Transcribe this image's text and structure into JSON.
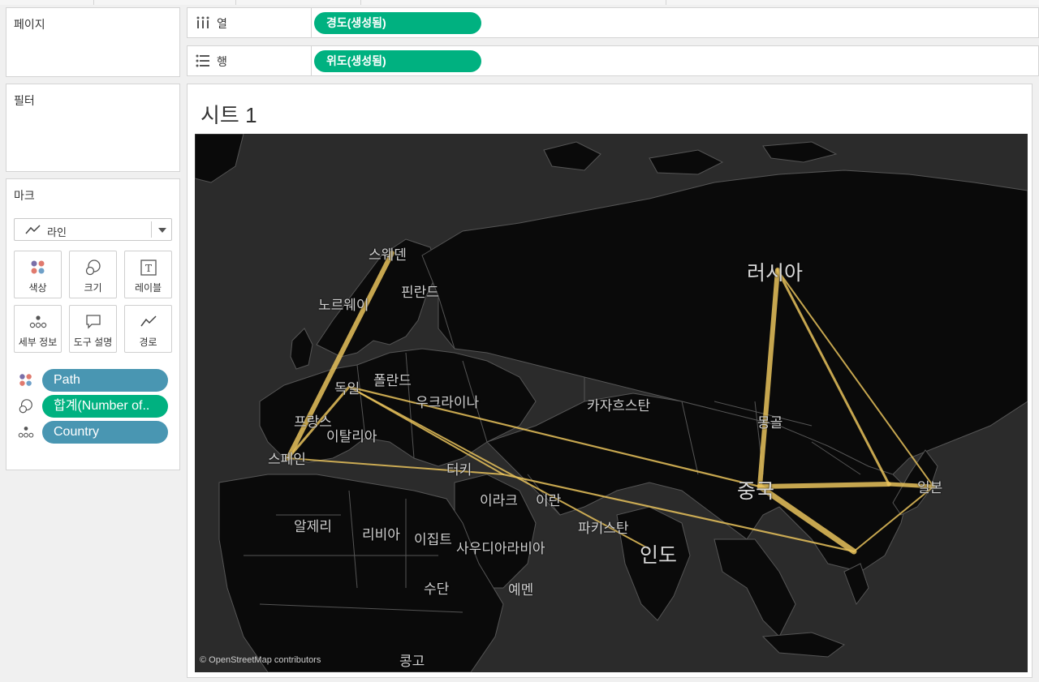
{
  "shelves": {
    "pages_label": "페이지",
    "filters_label": "필터",
    "columns": {
      "label": "열",
      "pill": "경도(생성됨)",
      "icon": "columns-icon"
    },
    "rows": {
      "label": "행",
      "pill": "위도(생성됨)",
      "icon": "rows-icon"
    }
  },
  "marks": {
    "title": "마크",
    "mark_type": "라인",
    "buttons": [
      {
        "label": "색상",
        "icon": "color-dots-icon"
      },
      {
        "label": "크기",
        "icon": "size-circles-icon"
      },
      {
        "label": "레이블",
        "icon": "text-label-icon"
      },
      {
        "label": "세부 정보",
        "icon": "detail-dots-icon"
      },
      {
        "label": "도구 설명",
        "icon": "tooltip-icon"
      },
      {
        "label": "경로",
        "icon": "path-line-icon"
      }
    ],
    "fields": [
      {
        "label": "Path",
        "color": "#4996b2",
        "icon": "color-dots-icon"
      },
      {
        "label": "합계(Number of..",
        "color": "#00b180",
        "icon": "size-circles-icon"
      },
      {
        "label": "Country",
        "color": "#4996b2",
        "icon": "detail-dots-icon"
      }
    ]
  },
  "sheet": {
    "title": "시트 1",
    "attribution": "© OpenStreetMap contributors",
    "line_color": "#e8c25c",
    "map_labels": {
      "sweden": "스웨덴",
      "finland": "핀란드",
      "norway": "노르웨이",
      "russia": "러시아",
      "germany": "독일",
      "poland": "폴란드",
      "ukraine": "우크라이나",
      "kazakhstan": "카자흐스탄",
      "france": "프랑스",
      "italy": "이탈리아",
      "mongolia": "몽골",
      "spain": "스페인",
      "turkey": "터키",
      "china": "중국",
      "japan": "일본",
      "iraq": "이라크",
      "iran": "이란",
      "algeria": "알제리",
      "libya": "리비아",
      "egypt": "이집트",
      "pakistan": "파키스탄",
      "saudi": "사우디아라비아",
      "india": "인도",
      "sudan": "수단",
      "yemen": "예멘",
      "congo": "콩고"
    }
  }
}
